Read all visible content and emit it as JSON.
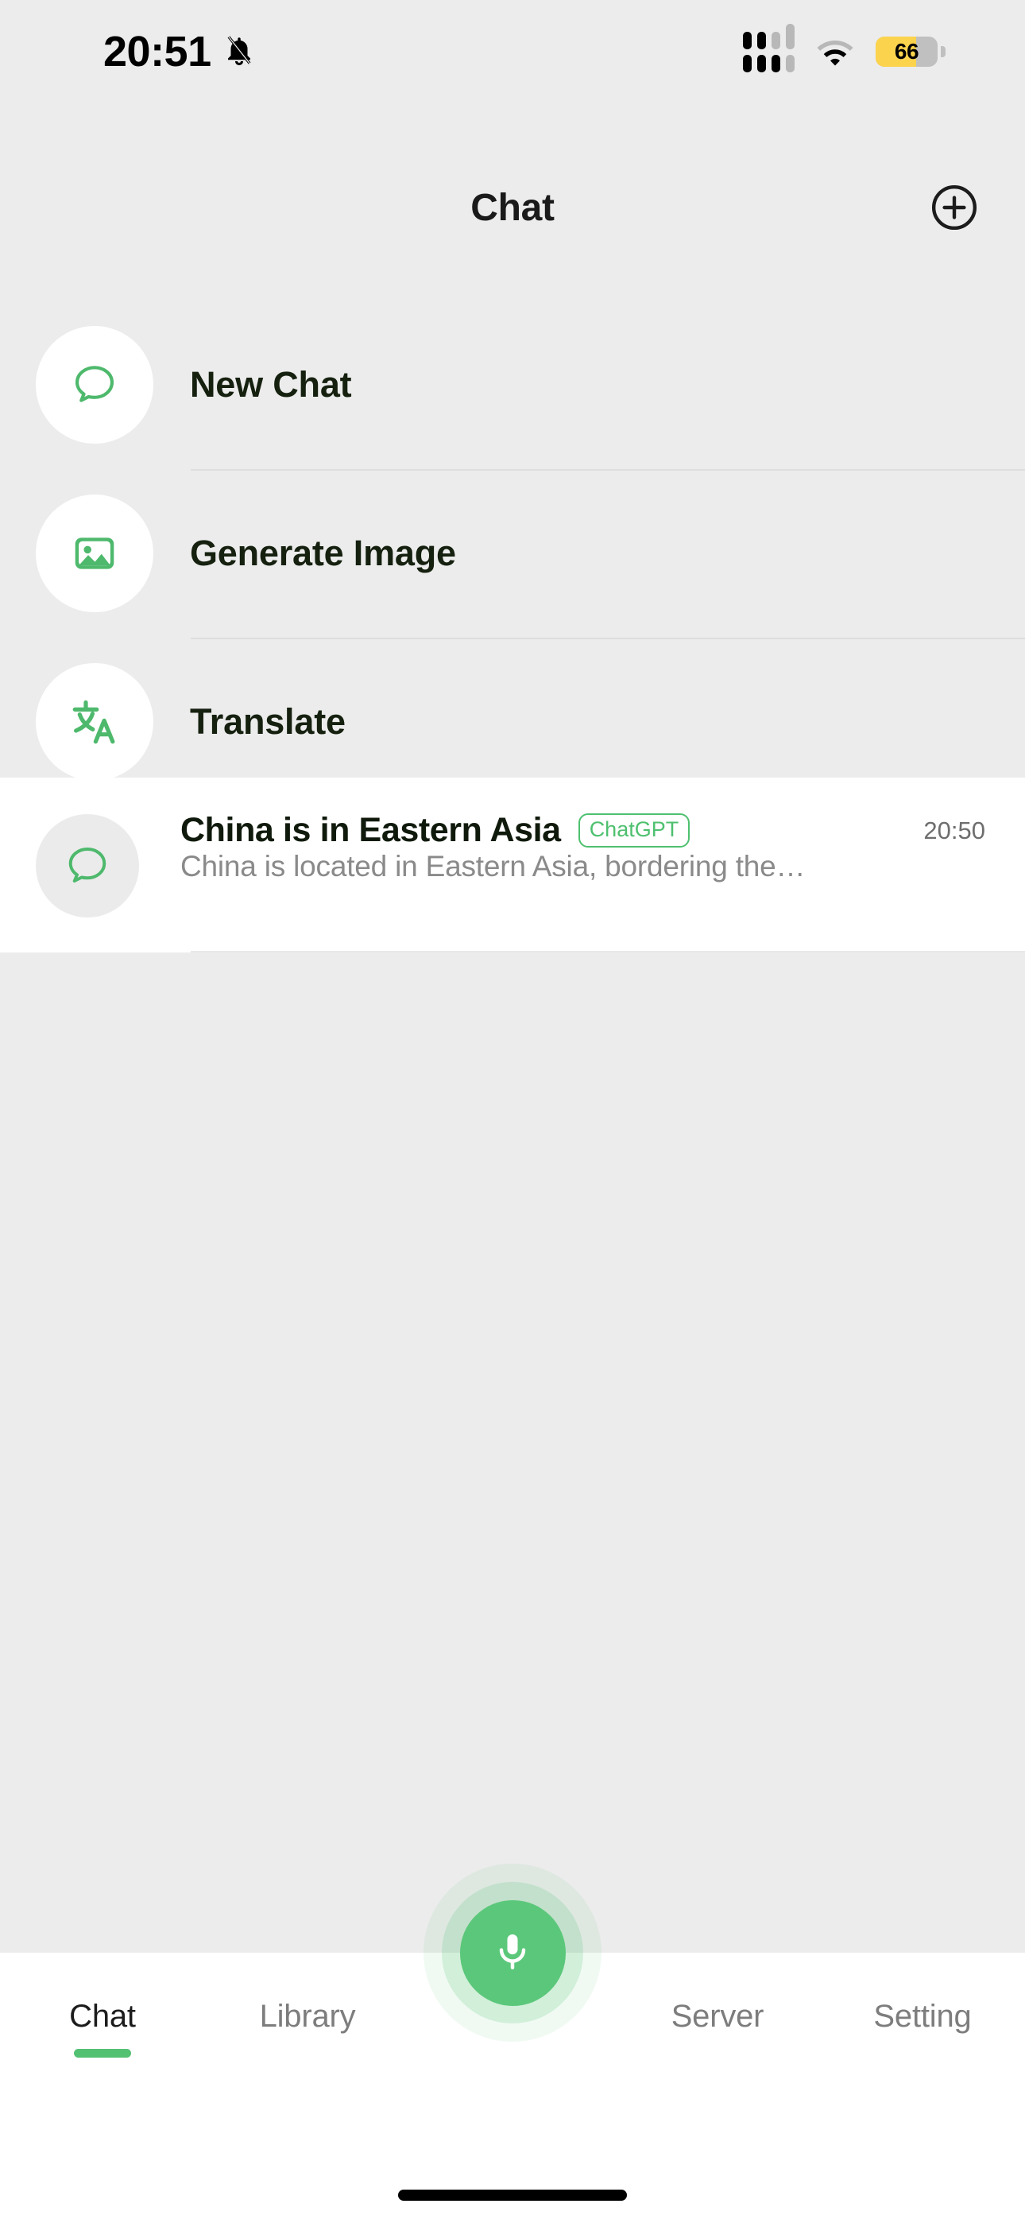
{
  "status_bar": {
    "time": "20:51",
    "silent_icon": "bell-slash-icon",
    "signal_icon": "cellular-signal-icon",
    "wifi_icon": "wifi-icon",
    "battery_level": "66",
    "battery_percent": 66,
    "battery_color": "#fcd34d"
  },
  "header": {
    "title": "Chat",
    "add_icon": "plus-circle-icon"
  },
  "actions": [
    {
      "label": "New Chat",
      "icon": "chat-bubble-icon"
    },
    {
      "label": "Generate Image",
      "icon": "image-icon"
    },
    {
      "label": "Translate",
      "icon": "translate-icon"
    }
  ],
  "chats": [
    {
      "title": "China is in Eastern Asia",
      "badge": "ChatGPT",
      "time": "20:50",
      "preview": "China is located in Eastern Asia, bordering the…",
      "icon": "chat-bubble-icon"
    }
  ],
  "tabs": [
    {
      "label": "Chat",
      "active": true
    },
    {
      "label": "Library",
      "active": false
    },
    {
      "label": "Server",
      "active": false
    },
    {
      "label": "Setting",
      "active": false
    }
  ],
  "mic_button": {
    "icon": "microphone-icon",
    "color": "#5bc77a"
  },
  "theme": {
    "accent": "#53c172",
    "background": "#ececec",
    "card": "#ffffff",
    "text_primary": "#15200f",
    "text_secondary": "#8a8a8a"
  }
}
